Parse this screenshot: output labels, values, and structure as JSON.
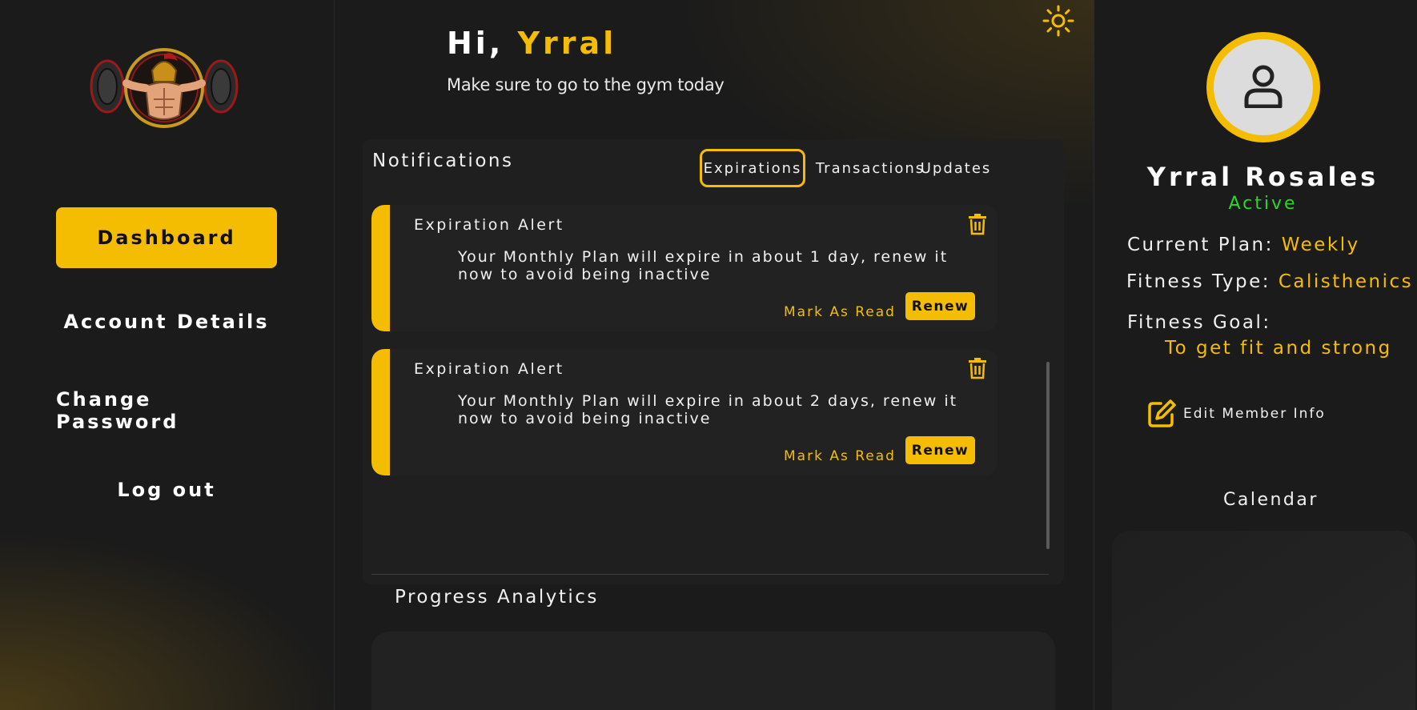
{
  "sidebar": {
    "logo": "gym-spartan-barbell-logo",
    "items": [
      {
        "label": "Dashboard",
        "active": true
      },
      {
        "label": "Account Details",
        "active": false
      },
      {
        "label": "Change Password",
        "active": false
      },
      {
        "label": "Log out",
        "active": false
      }
    ]
  },
  "header": {
    "greeting_prefix": "Hi,",
    "user_first_name": "Yrral",
    "subtitle": "Make sure to go to the gym today",
    "theme_icon": "sun-icon"
  },
  "notifications": {
    "title": "Notifications",
    "tabs": [
      {
        "label": "Expirations",
        "active": true
      },
      {
        "label": "Transactions",
        "active": false
      },
      {
        "label": "Updates",
        "active": false
      }
    ],
    "items": [
      {
        "title": "Expiration Alert",
        "message": "Your Monthly Plan will expire in about 1 day, renew it now to avoid being inactive",
        "mark_read_label": "Mark As Read",
        "renew_label": "Renew"
      },
      {
        "title": "Expiration Alert",
        "message": "Your Monthly Plan will expire in about 2 days, renew it now to avoid being inactive",
        "mark_read_label": "Mark As Read",
        "renew_label": "Renew"
      }
    ]
  },
  "progress": {
    "title": "Progress Analytics"
  },
  "profile": {
    "name": "Yrral Rosales",
    "status": "Active",
    "current_plan_label": "Current Plan:",
    "current_plan": "Weekly",
    "fitness_type_label": "Fitness Type:",
    "fitness_type": "Calisthenics",
    "fitness_goal_label": "Fitness Goal:",
    "fitness_goal": "To get fit and strong",
    "edit_label": "Edit Member Info"
  },
  "calendar": {
    "title": "Calendar"
  },
  "colors": {
    "accent": "#f5bd02",
    "active_status": "#27d827",
    "background": "#1b1b1b"
  }
}
